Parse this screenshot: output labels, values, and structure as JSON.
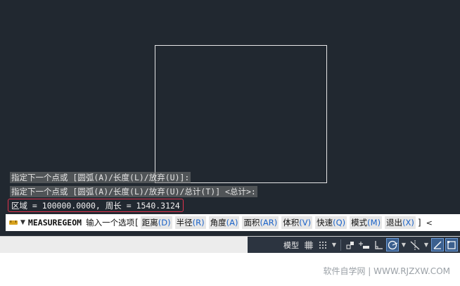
{
  "history": {
    "line1": "指定下一个点或 [圆弧(A)/长度(L)/放弃(U)]:",
    "line2": "指定下一个点或 [圆弧(A)/长度(L)/放弃(U)/总计(T)] <总计>:"
  },
  "result": {
    "text": "区域 = 100000.0000, 周长 = 1540.3124"
  },
  "command_line": {
    "icon": "ruler-icon",
    "command": "MEASUREGEOM",
    "prompt": "输入一个选项",
    "open_bracket": "[",
    "close_bracket": "]",
    "trailing": "<",
    "options": [
      {
        "label": "距离",
        "key": "(D)"
      },
      {
        "label": "半径",
        "key": "(R)"
      },
      {
        "label": "角度",
        "key": "(A)"
      },
      {
        "label": "面积",
        "key": "(AR)"
      },
      {
        "label": "体积",
        "key": "(V)"
      },
      {
        "label": "快速",
        "key": "(Q)"
      },
      {
        "label": "模式",
        "key": "(M)"
      },
      {
        "label": "退出",
        "key": "(X)"
      }
    ]
  },
  "status_bar": {
    "model_label": "模型",
    "active_color": "#3b5f8e"
  },
  "watermark": "软件自学网 | WWW.RJZXW.COM",
  "colors": {
    "canvas_bg": "#212830",
    "highlight_border": "#e0324d",
    "option_key": "#1b63c9"
  }
}
